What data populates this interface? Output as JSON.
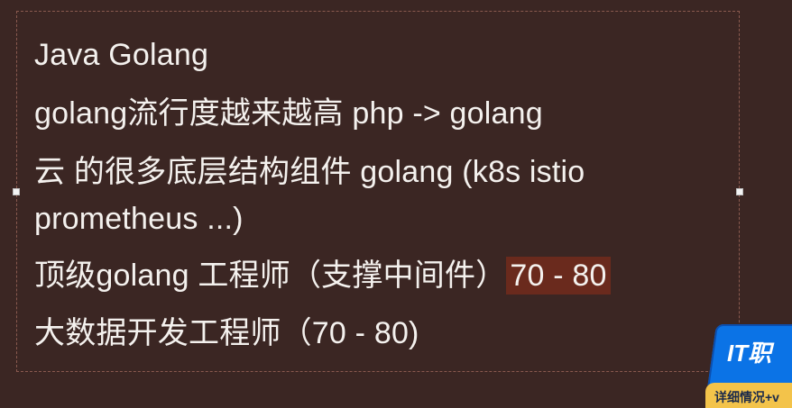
{
  "slide": {
    "lines": [
      "Java Golang",
      "golang流行度越来越高 php -> golang",
      "云 的很多底层结构组件 golang (k8s istio",
      "prometheus ...)",
      "顶级golang 工程师（支撑中间件）",
      "大数据开发工程师（70 - 80)"
    ],
    "highlight": "70 - 80"
  },
  "overlay": {
    "badge_main": "IT职",
    "badge_sub": "详细情况+v"
  },
  "colors": {
    "background": "#3b2623",
    "text": "#f4f1ee",
    "highlight": "#6a2a1d",
    "badge_blue": "#0b73e6",
    "badge_yellow": "#f3c34a"
  }
}
